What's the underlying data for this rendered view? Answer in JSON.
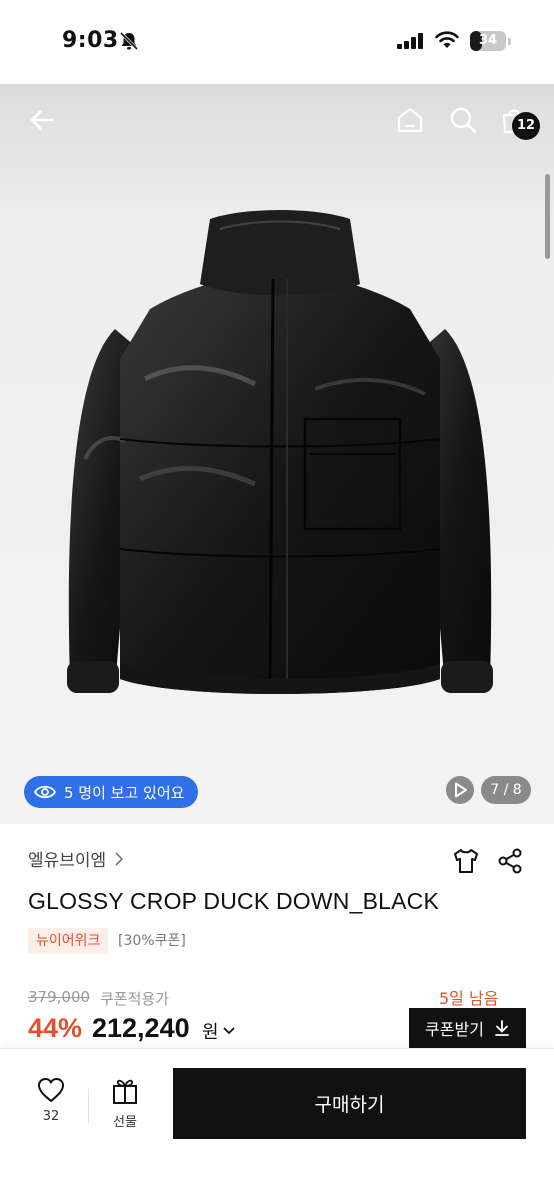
{
  "status": {
    "time": "9:03",
    "battery": "34",
    "battery_level_percent": 34
  },
  "nav": {
    "cart_count": "12"
  },
  "image": {
    "viewers_text": "5 명이 보고 있어요",
    "page_indicator": "7 / 8"
  },
  "product": {
    "brand": "엘유브이엠",
    "title": "GLOSSY CROP DUCK DOWN_BLACK",
    "tags": [
      "뉴이어위크",
      "[30%쿠폰]"
    ]
  },
  "pricing": {
    "original_price": "379,000",
    "coupon_applied_label": "쿠폰적용가",
    "days_left": "5일 남음",
    "discount": "44%",
    "price": "212,240",
    "currency": "원",
    "coupon_button": "쿠폰받기"
  },
  "bottom": {
    "likes": "32",
    "gift_label": "선물",
    "buy_label": "구매하기"
  },
  "colors": {
    "accent": "#e0522c",
    "badge_blue": "#2f6fe8",
    "black": "#111111"
  },
  "icons": [
    "back-arrow-icon",
    "home-icon",
    "search-icon",
    "shopping-bag-icon",
    "eye-icon",
    "play-icon",
    "chevron-right-icon",
    "tshirt-icon",
    "share-icon",
    "chevron-down-icon",
    "download-icon",
    "heart-icon",
    "gift-icon"
  ]
}
